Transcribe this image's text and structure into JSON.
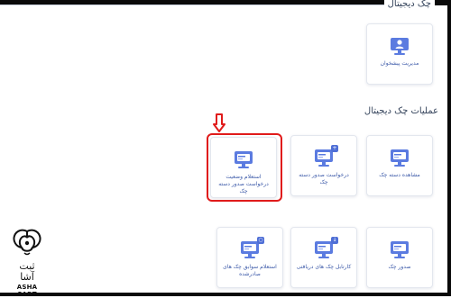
{
  "header": {
    "title": "چک دیجیتال"
  },
  "top_card": {
    "label": "مدیریت پیشخوان"
  },
  "section": {
    "title": "عملیات چک دیجیتال"
  },
  "cards": [
    {
      "label": "مشاهده دسته چک"
    },
    {
      "label": "درخواست صدور دسته چک"
    },
    {
      "label": "استعلام وضعیت درخواست صدور دسته چک"
    },
    {
      "label": "صدور چک"
    },
    {
      "label": "کارتابل چک های دریافتی"
    },
    {
      "label": "استعلام سوابق چک های صادرشده"
    }
  ],
  "logo": {
    "fa": "ثبت آشا",
    "en": "ASHA SABT"
  },
  "colors": {
    "highlight": "#e01b1b",
    "accent": "#4f6fd6",
    "label": "#3a58a8"
  }
}
